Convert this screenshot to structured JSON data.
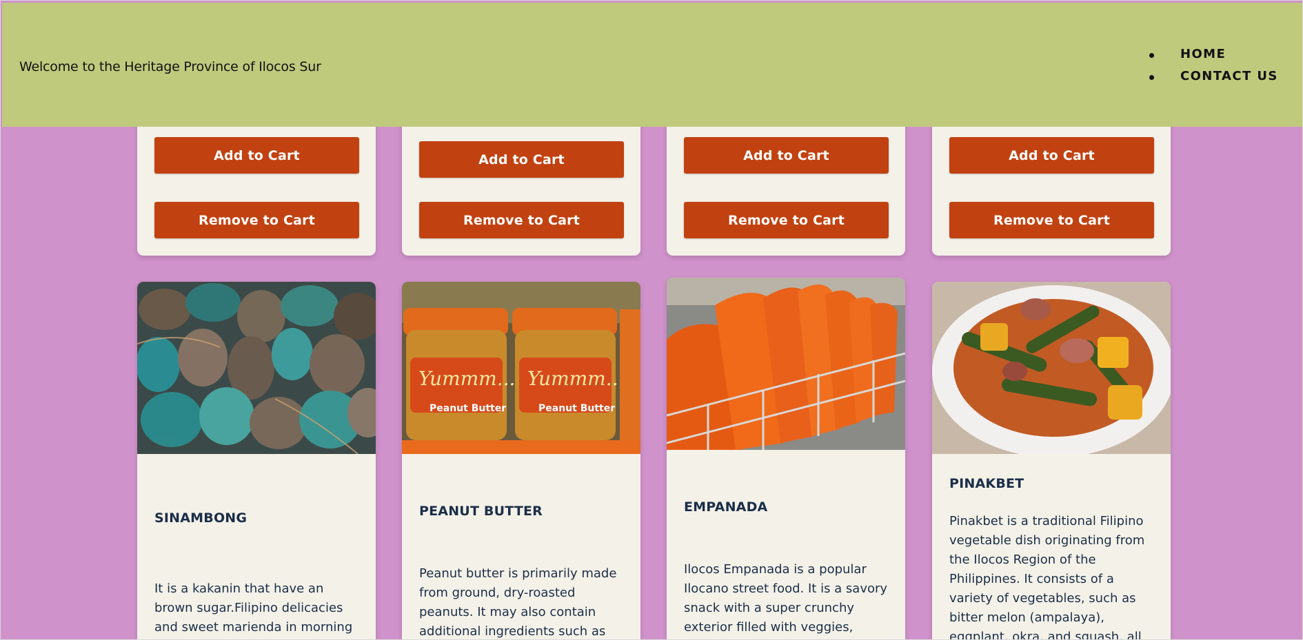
{
  "header": {
    "welcome": "Welcome to the Heritage Province of Ilocos Sur",
    "nav": [
      "HOME",
      "CONTACT US"
    ]
  },
  "top_cards": [
    {
      "add_label": "Add to Cart",
      "remove_label": "Remove to Cart"
    },
    {
      "add_label": "Add to Cart",
      "remove_label": "Remove to Cart"
    },
    {
      "add_label": "Add to Cart",
      "remove_label": "Remove to Cart"
    },
    {
      "add_label": "Add to Cart",
      "remove_label": "Remove to Cart"
    }
  ],
  "products": [
    {
      "title": "SINAMBONG",
      "description": "It is a kakanin that have an brown sugar.Filipino delicacies and sweet marienda in morning and",
      "image_alt": "sinambong-photo"
    },
    {
      "title": "PEANUT BUTTER",
      "description": "Peanut butter is primarily made from ground, dry-roasted peanuts. It may also contain additional ingredients such as",
      "image_alt": "peanut-butter-photo",
      "jar_label": "Yummm...",
      "jar_sublabel": "Peanut Butter"
    },
    {
      "title": "EMPANADA",
      "description": "Ilocos Empanada is a popular Ilocano street food. It is a savory snack with a super crunchy exterior filled with veggies,",
      "image_alt": "empanada-photo"
    },
    {
      "title": "PINAKBET",
      "description": "Pinakbet is a traditional Filipino vegetable dish originating from the Ilocos Region of the Philippines. It consists of a variety of vegetables, such as bitter melon (ampalaya), eggplant, okra, and squash, all",
      "image_alt": "pinakbet-photo"
    }
  ]
}
